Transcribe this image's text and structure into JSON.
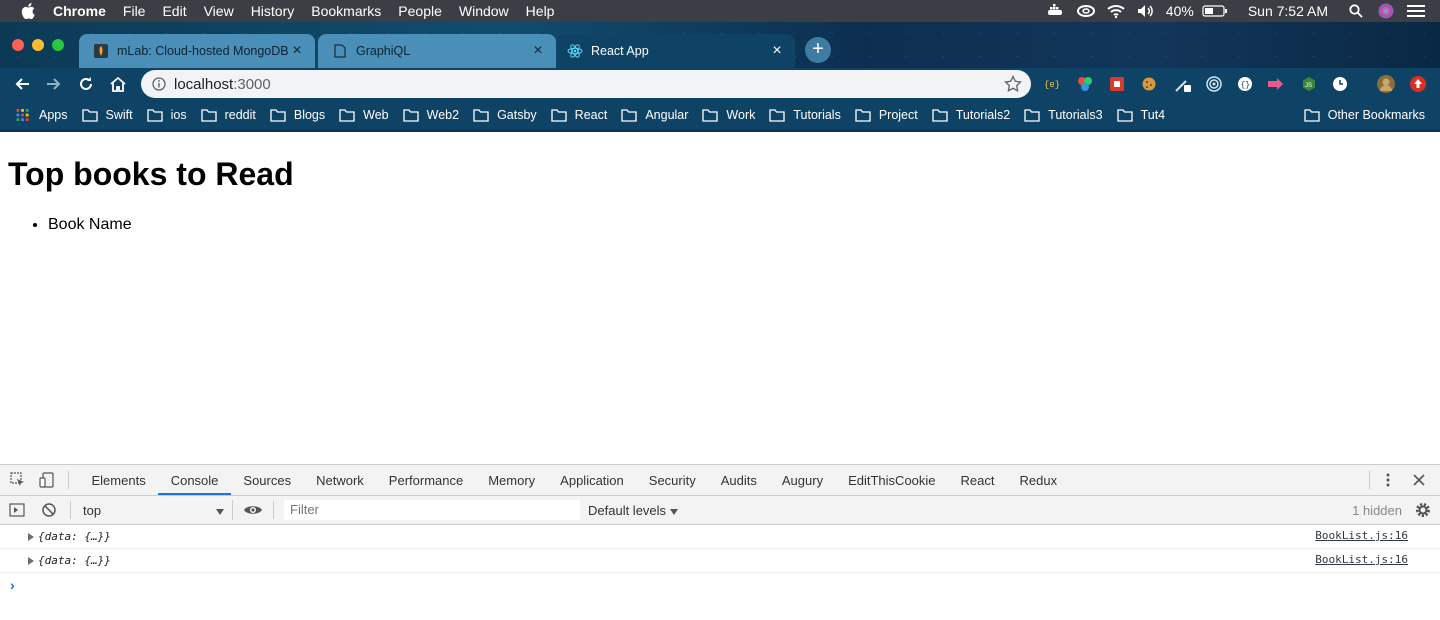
{
  "menubar": {
    "app": "Chrome",
    "items": [
      "File",
      "Edit",
      "View",
      "History",
      "Bookmarks",
      "People",
      "Window",
      "Help"
    ],
    "battery": "40%",
    "clock": "Sun 7:52 AM"
  },
  "tabs": [
    {
      "title": "mLab: Cloud-hosted MongoDB",
      "state": "inactive"
    },
    {
      "title": "GraphiQL",
      "state": "inactive"
    },
    {
      "title": "React App",
      "state": "active"
    }
  ],
  "omnibox": {
    "host": "localhost",
    "port": ":3000"
  },
  "bookmarks": {
    "apps": "Apps",
    "folders": [
      "Swift",
      "ios",
      "reddit",
      "Blogs",
      "Web",
      "Web2",
      "Gatsby",
      "React",
      "Angular",
      "Work",
      "Tutorials",
      "Project",
      "Tutorials2",
      "Tutorials3",
      "Tut4"
    ],
    "other": "Other Bookmarks"
  },
  "page": {
    "heading": "Top books to Read",
    "list": [
      "Book Name"
    ]
  },
  "devtools": {
    "tabs": [
      "Elements",
      "Console",
      "Sources",
      "Network",
      "Performance",
      "Memory",
      "Application",
      "Security",
      "Audits",
      "Augury",
      "EditThisCookie",
      "React",
      "Redux"
    ],
    "active_tab": "Console",
    "context": "top",
    "filter_placeholder": "Filter",
    "levels": "Default levels",
    "hidden": "1 hidden",
    "logs": [
      {
        "message": "{data: {…}}",
        "source": "BookList.js:16"
      },
      {
        "message": "{data: {…}}",
        "source": "BookList.js:16"
      }
    ],
    "prompt": "›"
  },
  "colors": {
    "accent": "#1a73e8",
    "toolbar": "#0f4365",
    "tab_inactive": "#4a8fb8"
  }
}
